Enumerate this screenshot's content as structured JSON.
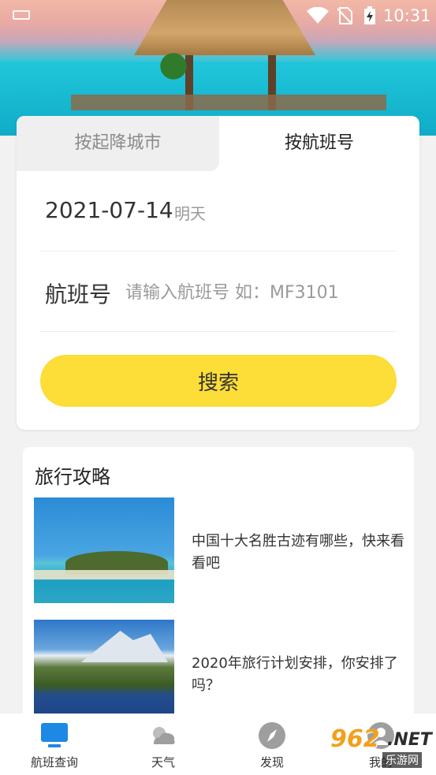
{
  "status_bar": {
    "time": "10:31"
  },
  "tabs": {
    "by_city": "按起降城市",
    "by_flight": "按航班号"
  },
  "date_row": {
    "date": "2021-07-14",
    "relative": "明天"
  },
  "flight_row": {
    "label": "航班号",
    "placeholder": "请输入航班号 如：MF3101",
    "value": ""
  },
  "search": {
    "label": "搜索"
  },
  "guide": {
    "title": "旅行攻略",
    "articles": [
      {
        "title": "中国十大名胜古迹有哪些，快来看看吧"
      },
      {
        "title": "2020年旅行计划安排，你安排了吗？"
      }
    ]
  },
  "bottom_nav": {
    "items": [
      {
        "label": "航班查询",
        "icon": "monitor-icon",
        "active": true
      },
      {
        "label": "天气",
        "icon": "weather-icon"
      },
      {
        "label": "发现",
        "icon": "compass-icon"
      },
      {
        "label": "我的",
        "icon": "profile-icon"
      }
    ]
  },
  "watermark": {
    "number": "962",
    "domain": ".NET",
    "subtitle": "乐游网"
  },
  "colors": {
    "accent": "#fddd37",
    "nav_active": "#1e88e5",
    "nav_inactive": "#9e9e9e"
  }
}
